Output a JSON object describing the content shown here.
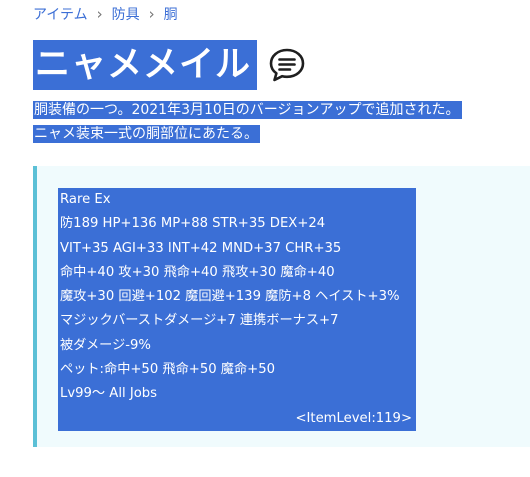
{
  "breadcrumb": {
    "items": [
      "アイテム",
      "防具",
      "胴"
    ],
    "separator": "›"
  },
  "title": "ニャメメイル",
  "icons": {
    "comment": "speech-bubble-icon"
  },
  "description": [
    "胴装備の一つ。2021年3月10日のバージョンアップで追加された。",
    "ニャメ装束一式の胴部位にあたる。"
  ],
  "item_stats": {
    "lines": [
      "Rare Ex",
      "防189 HP+136 MP+88 STR+35 DEX+24",
      "VIT+35 AGI+33 INT+42 MND+37 CHR+35",
      "命中+40 攻+30 飛命+40 飛攻+30 魔命+40",
      "魔攻+30 回避+102 魔回避+139 魔防+8 ヘイスト+3%",
      "マジックバーストダメージ+7 連携ボーナス+7",
      "被ダメージ-9%",
      "ペット:命中+50 飛命+50 魔命+50",
      "Lv99～ All Jobs"
    ],
    "item_level": "<ItemLevel:119>"
  },
  "colors": {
    "link": "#3c6fd6",
    "selection": "#3b6fd6",
    "box_background": "#f0fbfd",
    "box_border": "#5bc0d6"
  }
}
